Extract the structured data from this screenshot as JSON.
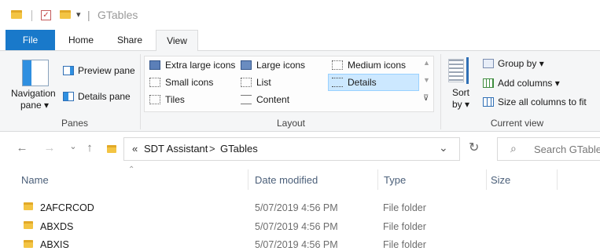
{
  "titlebar": {
    "title": "GTables",
    "separator": "|",
    "dropdown_glyph": "▾"
  },
  "tabs": [
    {
      "label": "File"
    },
    {
      "label": "Home"
    },
    {
      "label": "Share"
    },
    {
      "label": "View"
    }
  ],
  "ribbon": {
    "panes": {
      "navigation_pane_line1": "Navigation",
      "navigation_pane_line2": "pane ▾",
      "preview_pane": "Preview pane",
      "details_pane": "Details pane",
      "group_label": "Panes"
    },
    "layout": {
      "items": [
        "Extra large icons",
        "Large icons",
        "Medium icons",
        "Small icons",
        "List",
        "Details",
        "Tiles",
        "Content"
      ],
      "selected": "Details",
      "group_label": "Layout"
    },
    "current_view": {
      "sort_line1": "Sort",
      "sort_line2": "by ▾",
      "group_by": "Group by ▾",
      "add_columns": "Add columns ▾",
      "size_all_columns": "Size all columns to fit",
      "group_label": "Current view"
    }
  },
  "address": {
    "overflow": "«",
    "breadcrumb": [
      "SDT Assistant",
      "GTables"
    ],
    "chevron": ">",
    "search_placeholder": "Search GTables"
  },
  "file_list": {
    "columns": [
      "Name",
      "Date modified",
      "Type",
      "Size"
    ],
    "rows": [
      {
        "name": "2AFCRCOD",
        "date": "5/07/2019 4:56 PM",
        "type": "File folder"
      },
      {
        "name": "ABXDS",
        "date": "5/07/2019 4:56 PM",
        "type": "File folder"
      },
      {
        "name": "ABXIS",
        "date": "5/07/2019 4:56 PM",
        "type": "File folder"
      }
    ]
  },
  "colors": {
    "file_tab": "#1979ca",
    "selection": "#cce8ff",
    "folder": "#f3c443"
  },
  "icons": [
    "folder-icon",
    "checkmark-icon",
    "back-arrow-icon",
    "forward-arrow-icon",
    "recent-chevron-icon",
    "up-arrow-icon",
    "refresh-icon",
    "search-icon"
  ]
}
